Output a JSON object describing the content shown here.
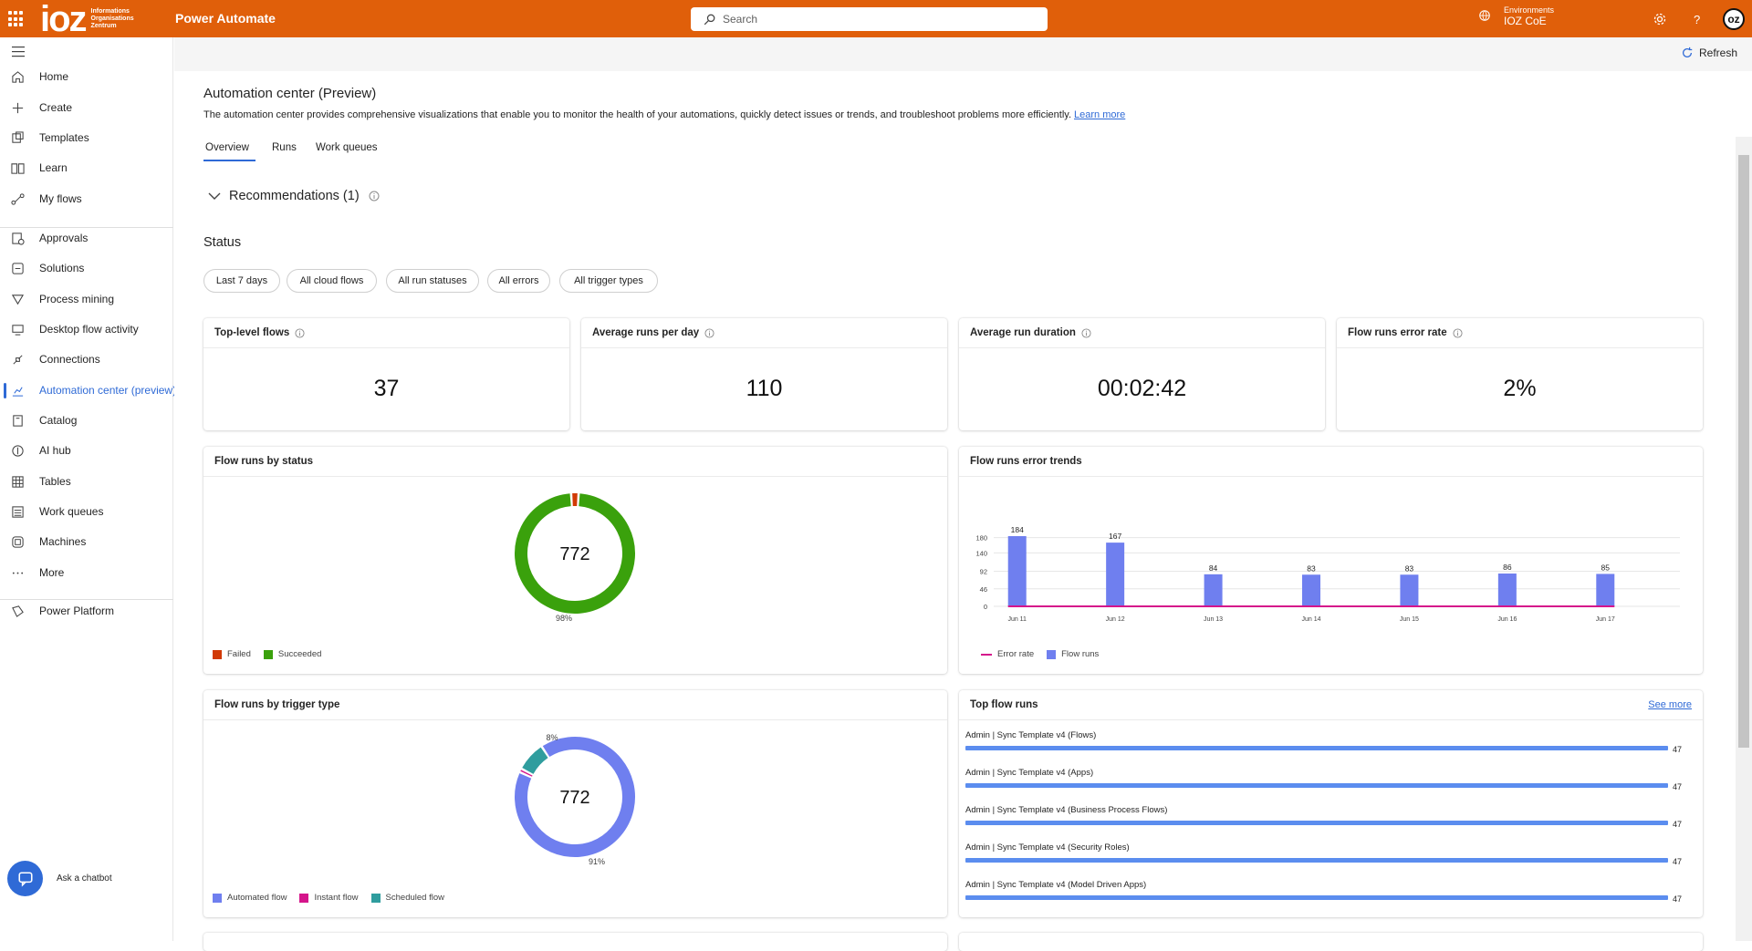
{
  "header": {
    "logo_mark": "ioz",
    "logo_sub_1": "Informations",
    "logo_sub_2": "Organisations",
    "logo_sub_3": "Zentrum",
    "app_name": "Power Automate",
    "search_placeholder": "Search",
    "env_label": "Environments",
    "env_name": "IOZ CoE",
    "avatar": "oz",
    "color": "#e05f0a"
  },
  "sidebar": {
    "items": [
      {
        "label": "Home",
        "icon": "home-icon"
      },
      {
        "label": "Create",
        "icon": "plus-icon"
      },
      {
        "label": "Templates",
        "icon": "templates-icon"
      },
      {
        "label": "Learn",
        "icon": "book-icon"
      },
      {
        "label": "My flows",
        "icon": "flows-icon"
      },
      {
        "label": "Approvals",
        "icon": "approvals-icon"
      },
      {
        "label": "Solutions",
        "icon": "solutions-icon"
      },
      {
        "label": "Process mining",
        "icon": "process-mining-icon"
      },
      {
        "label": "Desktop flow activity",
        "icon": "desktop-flow-icon"
      },
      {
        "label": "Connections",
        "icon": "connections-icon"
      },
      {
        "label": "Automation center (preview)",
        "icon": "chart-icon"
      },
      {
        "label": "Catalog",
        "icon": "catalog-icon"
      },
      {
        "label": "AI hub",
        "icon": "ai-hub-icon"
      },
      {
        "label": "Tables",
        "icon": "table-icon"
      },
      {
        "label": "Work queues",
        "icon": "work-queues-icon"
      },
      {
        "label": "Machines",
        "icon": "machine-icon"
      },
      {
        "label": "More",
        "icon": "more-icon"
      },
      {
        "label": "Power Platform",
        "icon": "power-platform-icon"
      }
    ],
    "chatbot": "Ask a chatbot"
  },
  "cmdbar": {
    "refresh": "Refresh"
  },
  "page": {
    "title": "Automation center (Preview)",
    "description": "The automation center provides comprehensive visualizations that enable you to monitor the health of your automations, quickly detect issues or trends, and troubleshoot problems more efficiently.",
    "learn_more": "Learn more",
    "tabs": [
      "Overview",
      "Runs",
      "Work queues"
    ],
    "recommendations": "Recommendations (1)",
    "status_heading": "Status",
    "filters": [
      "Last 7 days",
      "All cloud flows",
      "All run statuses",
      "All errors",
      "All trigger types"
    ]
  },
  "kpis": [
    {
      "label": "Top-level flows",
      "value": "37"
    },
    {
      "label": "Average runs per day",
      "value": "110"
    },
    {
      "label": "Average run duration",
      "value": "00:02:42"
    },
    {
      "label": "Flow runs error rate",
      "value": "2%"
    }
  ],
  "cards": {
    "status_title": "Flow runs by status",
    "error_trends_title": "Flow runs error trends",
    "trigger_title": "Flow runs by trigger type",
    "top_runs_title": "Top flow runs",
    "see_more": "See more"
  },
  "chart_data": [
    {
      "type": "pie",
      "title": "Flow runs by status",
      "center_label": "772",
      "categories": [
        "Failed",
        "Succeeded"
      ],
      "values": [
        2,
        98
      ],
      "colors": [
        "#d13a06",
        "#3aa10c"
      ],
      "slice_label": "98%",
      "legend": "bottom-left"
    },
    {
      "type": "bar",
      "title": "Flow runs error trends",
      "categories": [
        "Jun 11",
        "Jun 12",
        "Jun 13",
        "Jun 14",
        "Jun 15",
        "Jun 16",
        "Jun 17"
      ],
      "series": [
        {
          "name": "Flow runs",
          "values": [
            184,
            167,
            84,
            83,
            83,
            86,
            85
          ],
          "color": "#6f7fef"
        },
        {
          "name": "Error rate",
          "values": [
            0,
            0,
            0,
            0,
            0,
            0,
            0
          ],
          "color": "#d5158b"
        }
      ],
      "yticks": [
        "0",
        "46",
        "92",
        "140",
        "180"
      ],
      "ylim": [
        0,
        184
      ],
      "grid": true,
      "legend": "bottom-left"
    },
    {
      "type": "pie",
      "title": "Flow runs by trigger type",
      "center_label": "772",
      "categories": [
        "Automated flow",
        "Instant flow",
        "Scheduled flow"
      ],
      "values": [
        91,
        1,
        8
      ],
      "colors": [
        "#6f7fef",
        "#d5158b",
        "#2f9d9e"
      ],
      "slice_labels": [
        "91%",
        "",
        "8%"
      ],
      "legend": "bottom-left"
    },
    {
      "type": "bar",
      "title": "Top flow runs",
      "orientation": "horizontal",
      "categories": [
        "Admin | Sync Template v4 (Flows)",
        "Admin | Sync Template v4 (Apps)",
        "Admin | Sync Template v4 (Business Process Flows)",
        "Admin | Sync Template v4 (Security Roles)",
        "Admin | Sync Template v4 (Model Driven Apps)"
      ],
      "values": [
        47,
        47,
        47,
        47,
        47
      ],
      "color": "#5b8def"
    }
  ]
}
